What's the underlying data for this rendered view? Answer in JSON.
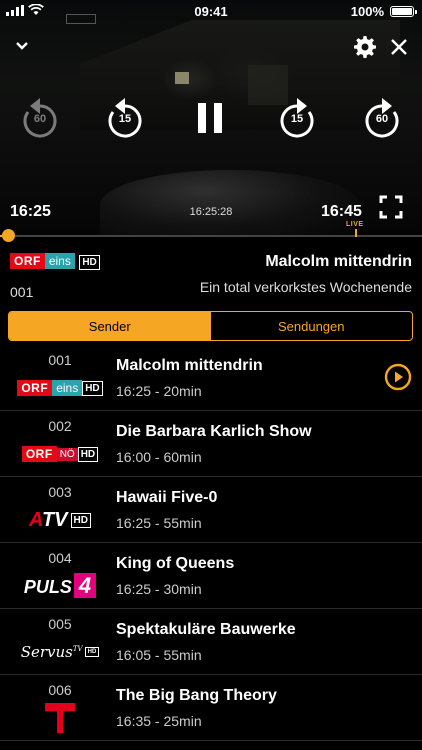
{
  "status_bar": {
    "time": "09:41",
    "battery": "100%"
  },
  "player": {
    "start_time": "16:25",
    "current_time": "16:25:28",
    "end_time": "16:45",
    "live_label": "LIVE",
    "back60_label": "60",
    "back15_label": "15",
    "fwd15_label": "15",
    "fwd60_label": "60",
    "progress_fraction": 0.01,
    "accent_color": "#f5a623"
  },
  "now_playing": {
    "channel_number": "001",
    "channel_logo": {
      "orf": "ORF",
      "eins": "eins",
      "hd": "HD"
    },
    "title": "Malcolm mittendrin",
    "subtitle": "Ein total verkorkstes Wochenende"
  },
  "tabs": {
    "sender": "Sender",
    "sendungen": "Sendungen",
    "active": "Sender"
  },
  "channels": [
    {
      "number": "001",
      "logo": "orf-eins-hd",
      "logo_text": [
        "ORF",
        "eins",
        "HD"
      ],
      "title": "Malcolm mittendrin",
      "time": "16:25 - 20min",
      "playing": true
    },
    {
      "number": "002",
      "logo": "orf-noe-hd",
      "logo_text": [
        "ORF",
        "NÖ",
        "HD"
      ],
      "title": "Die Barbara Karlich Show",
      "time": "16:00 - 60min"
    },
    {
      "number": "003",
      "logo": "atv-hd",
      "logo_text": [
        "A",
        "TV",
        "HD"
      ],
      "title": "Hawaii Five-0",
      "time": "16:25 - 55min"
    },
    {
      "number": "004",
      "logo": "puls-4",
      "logo_text": [
        "PULS",
        "4"
      ],
      "title": "King of Queens",
      "time": "16:25 - 30min"
    },
    {
      "number": "005",
      "logo": "servus-tv-hd",
      "logo_text": [
        "Servus",
        "TV",
        "HD"
      ],
      "title": "Spektakuläre Bauwerke",
      "time": "16:05 - 55min"
    },
    {
      "number": "006",
      "logo": "prosieben",
      "title": "The Big Bang Theory",
      "time": "16:35 - 25min"
    }
  ]
}
